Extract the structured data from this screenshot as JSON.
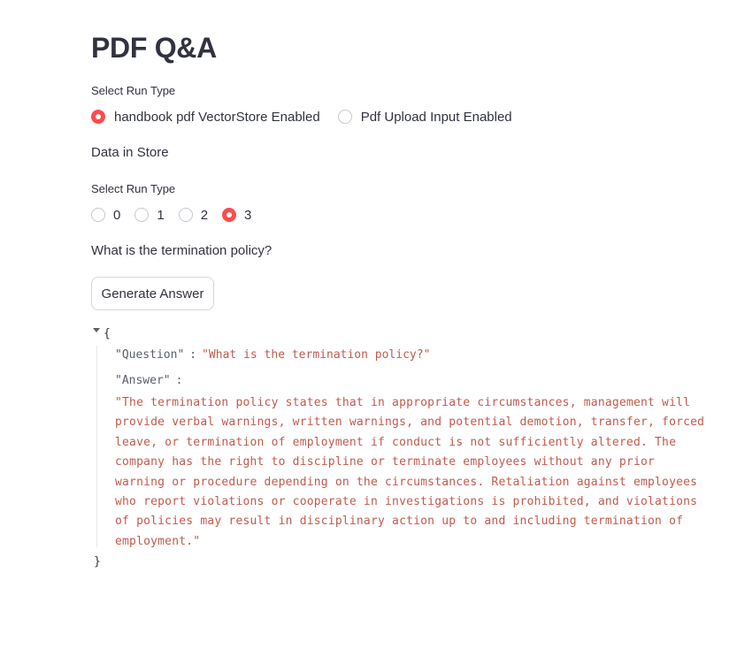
{
  "page": {
    "title": "PDF Q&A"
  },
  "run_type_1": {
    "label": "Select Run Type",
    "options": [
      {
        "label": "handbook pdf VectorStore Enabled",
        "checked": true
      },
      {
        "label": "Pdf Upload Input Enabled",
        "checked": false
      }
    ]
  },
  "store_text": "Data in Store",
  "run_type_2": {
    "label": "Select Run Type",
    "options": [
      {
        "label": "0",
        "checked": false
      },
      {
        "label": "1",
        "checked": false
      },
      {
        "label": "2",
        "checked": false
      },
      {
        "label": "3",
        "checked": true
      }
    ]
  },
  "question_text": "What is the termination policy?",
  "generate_button": {
    "label": "Generate Answer"
  },
  "json_output": {
    "open_brace": "{",
    "close_brace": "}",
    "question_key": "\"Question\"",
    "question_value": "\"What is the termination policy?\"",
    "answer_key": "\"Answer\"",
    "answer_value": "\"The termination policy states that in appropriate circumstances, management will provide verbal warnings, written warnings, and potential demotion, transfer, forced leave, or termination of employment if conduct is not sufficiently altered. The company has the right to discipline or terminate employees without any prior warning or procedure depending on the circumstances. Retaliation against employees who report violations or cooperate in investigations is prohibited, and violations of policies may result in disciplinary action up to and including termination of employment.\"",
    "colon": ":"
  },
  "colors": {
    "accent": "#ff4b4b",
    "text": "#31333F",
    "json_string": "#c05b4d",
    "json_key": "#5a5e6b"
  }
}
